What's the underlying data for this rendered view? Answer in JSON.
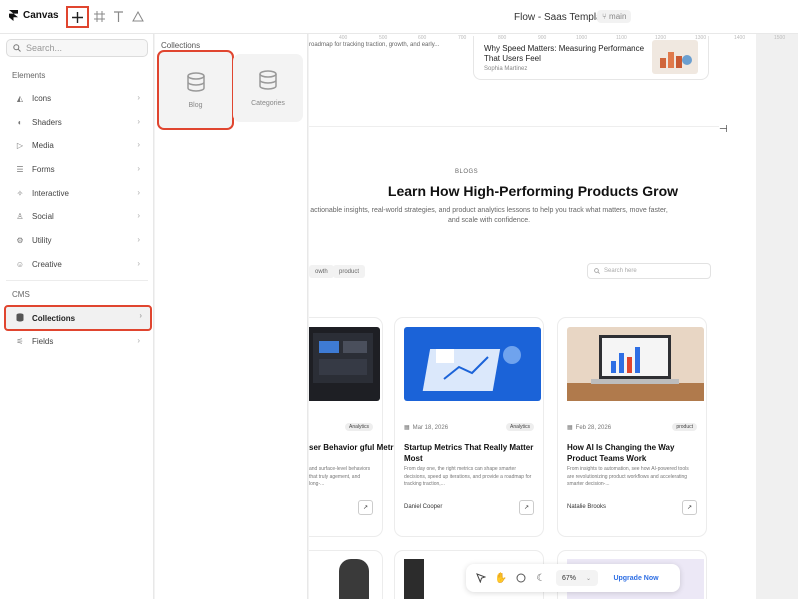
{
  "toolbar": {
    "brand": "Canvas",
    "add_icon": "plus-icon",
    "title": "Flow - Saas Template",
    "branch": "main"
  },
  "sidebar": {
    "search_placeholder": "Search...",
    "elements_label": "Elements",
    "items": [
      {
        "label": "Icons",
        "icon": "icons-icon"
      },
      {
        "label": "Shaders",
        "icon": "shaders-icon"
      },
      {
        "label": "Media",
        "icon": "media-icon"
      },
      {
        "label": "Forms",
        "icon": "forms-icon"
      },
      {
        "label": "Interactive",
        "icon": "interactive-icon"
      },
      {
        "label": "Social",
        "icon": "social-icon"
      },
      {
        "label": "Utility",
        "icon": "utility-icon"
      },
      {
        "label": "Creative",
        "icon": "creative-icon"
      }
    ],
    "cms_label": "CMS",
    "cms_items": [
      {
        "label": "Collections",
        "icon": "database-icon"
      },
      {
        "label": "Fields",
        "icon": "fields-icon"
      }
    ]
  },
  "collections_panel": {
    "title": "Collections",
    "cards": [
      {
        "label": "Blog"
      },
      {
        "label": "Categories"
      }
    ]
  },
  "ruler": [
    "400",
    "500",
    "600",
    "700",
    "800",
    "900",
    "1000",
    "1100",
    "1200",
    "1300",
    "1400",
    "1500"
  ],
  "canvas": {
    "top_text": "roadmap for tracking traction, growth, and early...",
    "top_card": {
      "title": "Why Speed Matters: Measuring Performance That Users Feel",
      "author": "Sophia Martinez"
    },
    "eyebrow": "BLOGS",
    "heading": "Learn How High-Performing Products Grow",
    "subtext": "actionable insights, real-world strategies, and product analytics lessons to help you track what matters, move faster, and scale with confidence.",
    "chips": [
      "owth",
      "product"
    ],
    "search_placeholder": "Search here",
    "cards": [
      {
        "date": "",
        "tag": "Analytics",
        "title": "ser Behavior gful Metrics",
        "excerpt": "and surface-level behaviors that truly agement, and long-...",
        "author": ""
      },
      {
        "date": "Mar 18, 2026",
        "tag": "Analytics",
        "title": "Startup Metrics That Really Matter Most",
        "excerpt": "From day one, the right metrics can shape smarter decisions, speed up iterations, and provide a roadmap for tracking traction,...",
        "author": "Daniel Cooper"
      },
      {
        "date": "Feb 28, 2026",
        "tag": "product",
        "title": "How AI Is Changing the Way Product Teams Work",
        "excerpt": "From insights to automation, see how AI-powered tools are revolutionizing product workflows and accelerating smarter decision-...",
        "author": "Natalie Brooks"
      }
    ]
  },
  "bottom_bar": {
    "zoom": "67%",
    "upgrade": "Upgrade Now"
  },
  "colors": {
    "highlight": "#e0452f",
    "accent": "#2f6fe4"
  }
}
